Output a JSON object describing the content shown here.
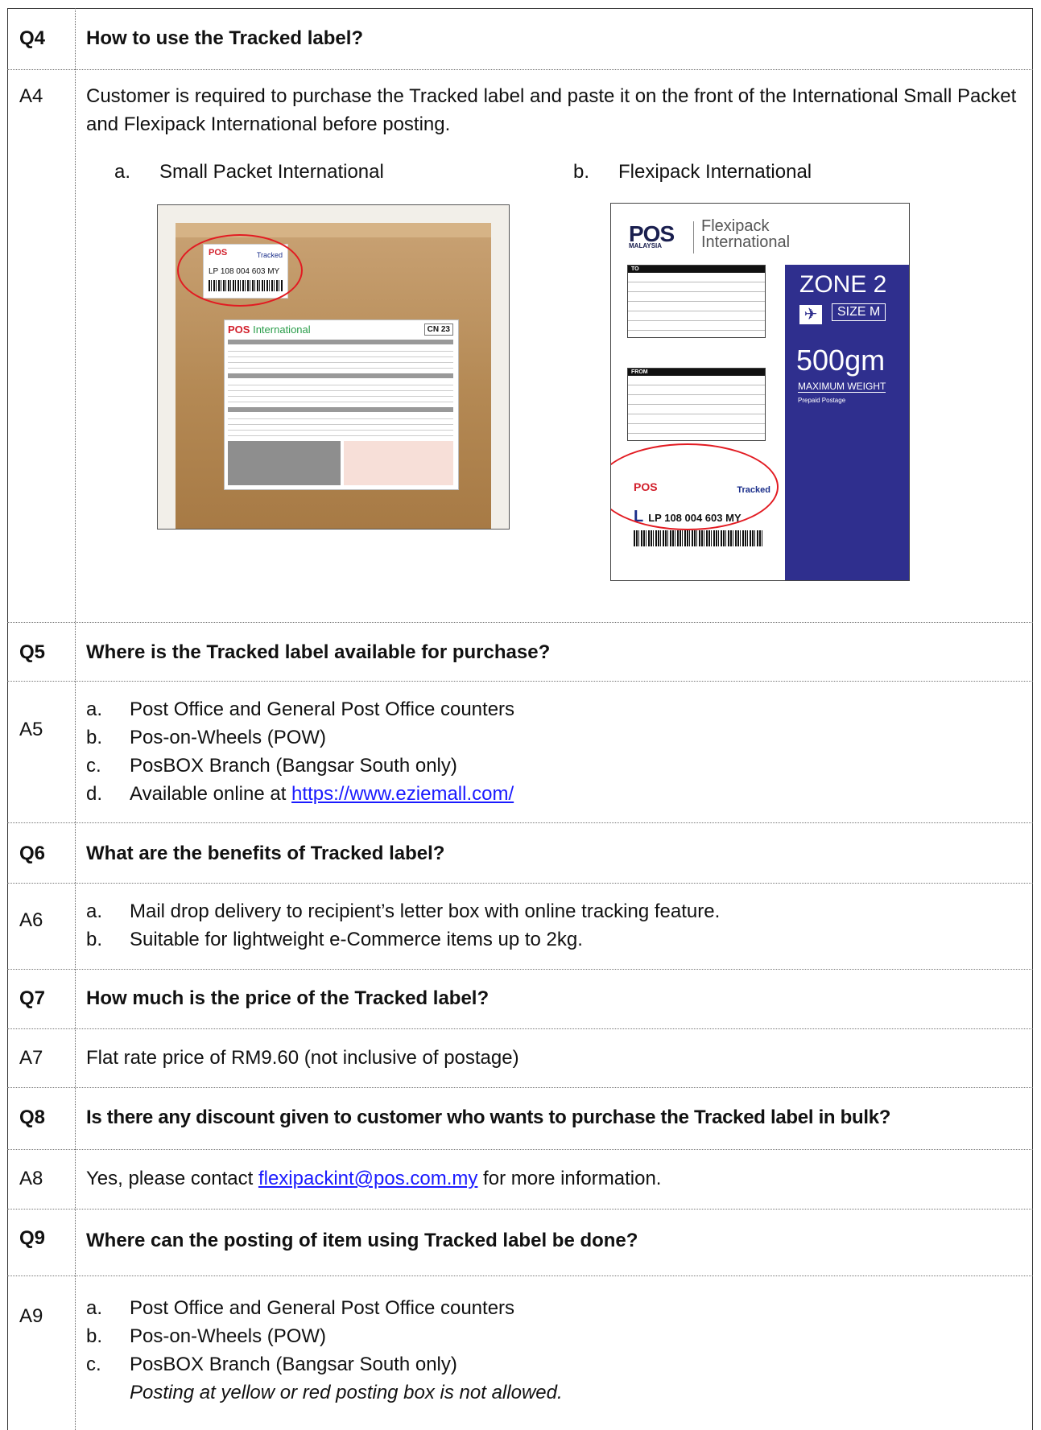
{
  "q4": {
    "num": "Q4",
    "question": "How to use the Tracked label?",
    "anum": "A4",
    "answer": "Customer is required to purchase the Tracked label and paste it on the front of the International Small Packet and Flexipack International before posting.",
    "items": [
      {
        "letter": "a.",
        "text": "Small Packet International"
      },
      {
        "letter": "b.",
        "text": "Flexipack International"
      }
    ]
  },
  "image_small_packet": {
    "label_brand": "POS",
    "label_tracked": "Tracked",
    "label_number": "LP 108 004 603 MY",
    "form_header_brand": "POS",
    "form_header_title": "International",
    "form_code": "CN 23"
  },
  "image_flexipack": {
    "brand": "POS",
    "brand_sub": "MALAYSIA",
    "title_line1": "Flexipack",
    "title_line2": "International",
    "to_header": "TO",
    "from_header": "FROM",
    "zone": "ZONE 2",
    "size": "SIZE M",
    "weight": "500gm",
    "weight_caption": "MAXIMUM WEIGHT",
    "prepaid": "Prepaid Postage",
    "label_brand": "POS",
    "label_tracked": "Tracked",
    "label_letter": "L",
    "label_number": "LP 108 004 603 MY"
  },
  "q5": {
    "num": "Q5",
    "question": "Where is the Tracked label available for purchase?",
    "anum": "A5",
    "items": [
      {
        "letter": "a.",
        "text": "Post Office and General Post Office counters"
      },
      {
        "letter": "b.",
        "text": "Pos-on-Wheels (POW)"
      },
      {
        "letter": "c.",
        "text": "PosBOX Branch (Bangsar South only)"
      },
      {
        "letter": "d.",
        "text": "Available online at ",
        "link": "https://www.eziemall.com/"
      }
    ]
  },
  "q6": {
    "num": "Q6",
    "question": "What are the benefits of Tracked label?",
    "anum": "A6",
    "items": [
      {
        "letter": "a.",
        "text": "Mail drop delivery to recipient’s letter box with online tracking feature."
      },
      {
        "letter": "b.",
        "text": "Suitable for lightweight e-Commerce items up to 2kg."
      }
    ]
  },
  "q7": {
    "num": "Q7",
    "question": "How much is the price of the Tracked label?",
    "anum": "A7",
    "answer": "Flat rate price of RM9.60 (not inclusive of postage)"
  },
  "q8": {
    "num": "Q8",
    "question": "Is there any discount given to customer who wants to purchase the Tracked label in bulk?",
    "anum": "A8",
    "answer_before": "Yes, please contact ",
    "email": "flexipackint@pos.com.my",
    "answer_after": " for more information."
  },
  "q9": {
    "num": "Q9",
    "question": "Where can the posting of item using Tracked label be done?",
    "anum": "A9",
    "items": [
      {
        "letter": "a.",
        "text": "Post Office and General Post Office counters"
      },
      {
        "letter": "b.",
        "text": "Pos-on-Wheels (POW)"
      },
      {
        "letter": "c.",
        "text": "PosBOX Branch (Bangsar South only)"
      }
    ],
    "note": "Posting at yellow or red posting box is not allowed."
  }
}
